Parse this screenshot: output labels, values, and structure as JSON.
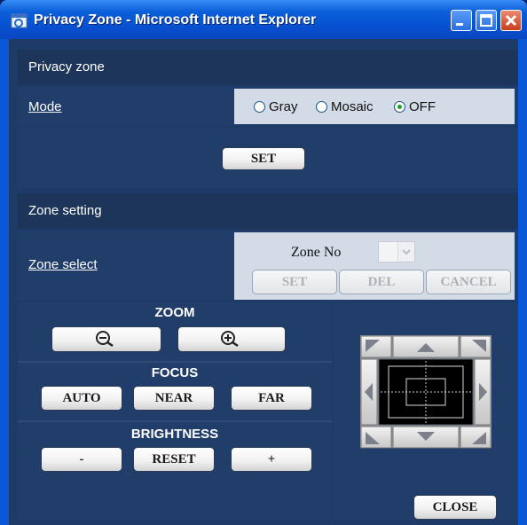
{
  "window": {
    "title": "Privacy Zone - Microsoft Internet Explorer",
    "buttons": {
      "min": "minimize",
      "max": "maximize",
      "close": "close"
    }
  },
  "privacy": {
    "header": "Privacy zone",
    "mode_label": "Mode",
    "mode_options": [
      "Gray",
      "Mosaic",
      "OFF"
    ],
    "mode_selected": "OFF",
    "set_button": "SET"
  },
  "zone": {
    "header": "Zone setting",
    "select_label": "Zone select",
    "zone_no_label": "Zone No",
    "zone_no_value": "",
    "set_button": "SET",
    "del_button": "DEL",
    "cancel_button": "CANCEL"
  },
  "zoom": {
    "title": "ZOOM",
    "out_icon": "zoom-out-icon",
    "in_icon": "zoom-in-icon"
  },
  "focus": {
    "title": "FOCUS",
    "auto": "AUTO",
    "near": "NEAR",
    "far": "FAR"
  },
  "brightness": {
    "title": "BRIGHTNESS",
    "minus": "-",
    "reset": "RESET",
    "plus": "+"
  },
  "footer": {
    "close_button": "CLOSE"
  },
  "colors": {
    "panel": "#1e3a66",
    "header": "#1c3559",
    "light": "#d3dbe7",
    "titlebar": "#0a5fd8"
  }
}
